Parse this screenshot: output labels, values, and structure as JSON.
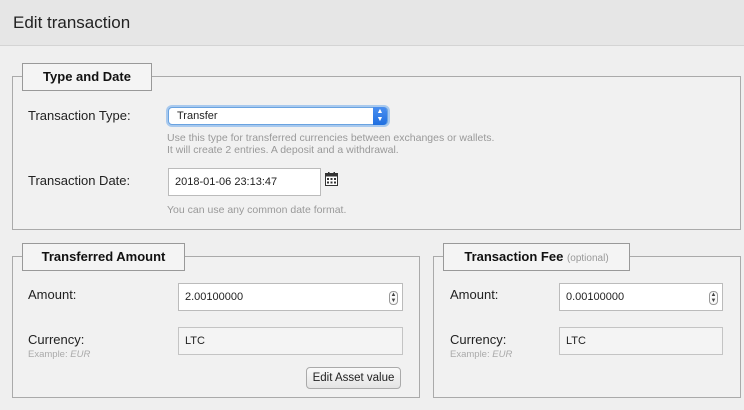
{
  "header": {
    "title": "Edit transaction"
  },
  "type_date": {
    "legend": "Type and Date",
    "type_label": "Transaction Type:",
    "type_value": "Transfer",
    "type_hint_1": "Use this type for transferred currencies between exchanges or wallets.",
    "type_hint_2": "It will create 2 entries. A deposit and a withdrawal.",
    "date_label": "Transaction Date:",
    "date_value": "2018-01-06 23:13:47",
    "date_hint": "You can use any common date format."
  },
  "transferred": {
    "legend": "Transferred Amount",
    "amount_label": "Amount:",
    "amount_value": "2.00100000",
    "currency_label": "Currency:",
    "currency_example_prefix": "Example: ",
    "currency_example": "EUR",
    "currency_value": "LTC",
    "edit_button": "Edit Asset value"
  },
  "fee": {
    "legend": "Transaction Fee",
    "legend_optional": "(optional)",
    "amount_label": "Amount:",
    "amount_value": "0.00100000",
    "currency_label": "Currency:",
    "currency_example_prefix": "Example: ",
    "currency_example": "EUR",
    "currency_value": "LTC"
  }
}
